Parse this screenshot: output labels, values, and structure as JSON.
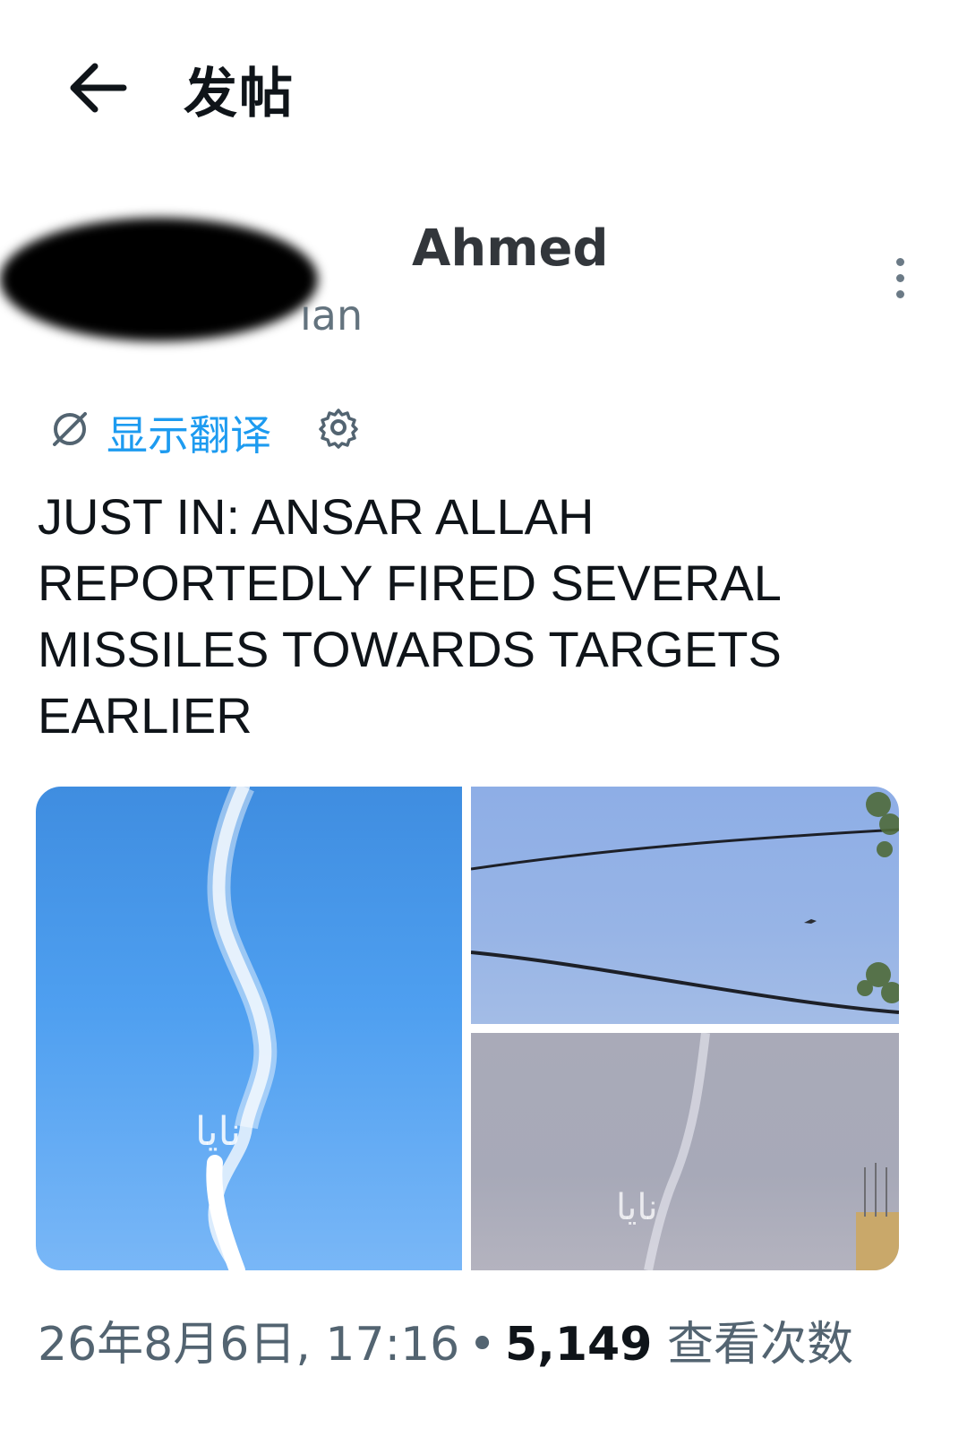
{
  "header": {
    "title": "发帖"
  },
  "author": {
    "display_name_visible": "Ahmed",
    "handle_visible": "ıan"
  },
  "translate": {
    "label": "显示翻译"
  },
  "post": {
    "text": "JUST IN: ANSAR ALLAH REPORTEDLY FIRED SEVERAL MISSILES TOWARDS TARGETS EARLIER"
  },
  "media": {
    "watermark_1": "نايا",
    "watermark_2": "نايا"
  },
  "meta": {
    "datetime": "26年8月6日, 17:16",
    "separator": "•",
    "views_count": "5,149",
    "views_label": "查看次数"
  },
  "icons": {
    "back": "arrow-left-icon",
    "translate": "globe-slash-icon",
    "settings": "gear-icon",
    "more": "more-vertical-icon"
  },
  "colors": {
    "link": "#1d9bf0",
    "secondary_text": "#536471",
    "primary_text": "#0f1419"
  }
}
